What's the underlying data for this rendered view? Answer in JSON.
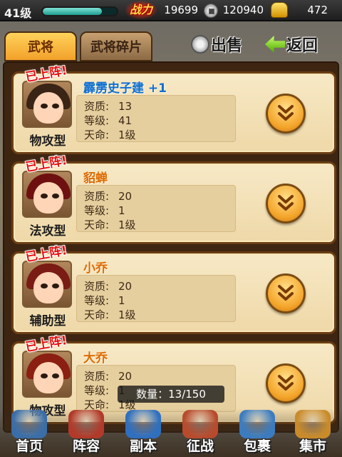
{
  "player": {
    "level_label": "41级",
    "exp_fraction": 0.8,
    "power_label": "战力",
    "power_value": "19699",
    "coins": "120940",
    "gold": "472"
  },
  "tabs": [
    {
      "label": "武将",
      "active": true
    },
    {
      "label": "武将碎片",
      "active": false
    }
  ],
  "actions": {
    "sell_label": "出售",
    "back_label": "返回"
  },
  "generals": [
    {
      "badge": "已上阵!",
      "name": "霹雳史子建 +1",
      "name_color": "#0f6fd0",
      "type": "物攻型",
      "hair_color": "#3a2416",
      "stats": [
        {
          "k": "资质:",
          "v": "13"
        },
        {
          "k": "等级:",
          "v": "41"
        },
        {
          "k": "天命:",
          "v": "1级"
        }
      ]
    },
    {
      "badge": "已上阵!",
      "name": "貂蝉",
      "name_color": "#e06a00",
      "type": "法攻型",
      "hair_color": "#6f1010",
      "stats": [
        {
          "k": "资质:",
          "v": "20"
        },
        {
          "k": "等级:",
          "v": "1"
        },
        {
          "k": "天命:",
          "v": "1级"
        }
      ]
    },
    {
      "badge": "已上阵!",
      "name": "小乔",
      "name_color": "#e06a00",
      "type": "辅助型",
      "hair_color": "#7a1c14",
      "stats": [
        {
          "k": "资质:",
          "v": "20"
        },
        {
          "k": "等级:",
          "v": "1"
        },
        {
          "k": "天命:",
          "v": "1级"
        }
      ]
    },
    {
      "badge": "已上阵!",
      "name": "大乔",
      "name_color": "#e06a00",
      "type": "物攻型",
      "hair_color": "#8a1f12",
      "stats": [
        {
          "k": "资质:",
          "v": "20"
        },
        {
          "k": "等级:",
          "v": "1"
        },
        {
          "k": "天命:",
          "v": "1级"
        }
      ]
    }
  ],
  "count_label": "数量：13/150",
  "nav": [
    {
      "label": "首页",
      "icon": "home-icon",
      "color": "#3a6ea8"
    },
    {
      "label": "阵容",
      "icon": "lineup-icon",
      "color": "#b23a2a"
    },
    {
      "label": "副本",
      "icon": "sword-icon",
      "color": "#2f6fbf"
    },
    {
      "label": "征战",
      "icon": "target-icon",
      "color": "#b84b2d"
    },
    {
      "label": "包裹",
      "icon": "bag-icon",
      "color": "#3b7cc0"
    },
    {
      "label": "集市",
      "icon": "market-icon",
      "color": "#c98b2a"
    }
  ]
}
